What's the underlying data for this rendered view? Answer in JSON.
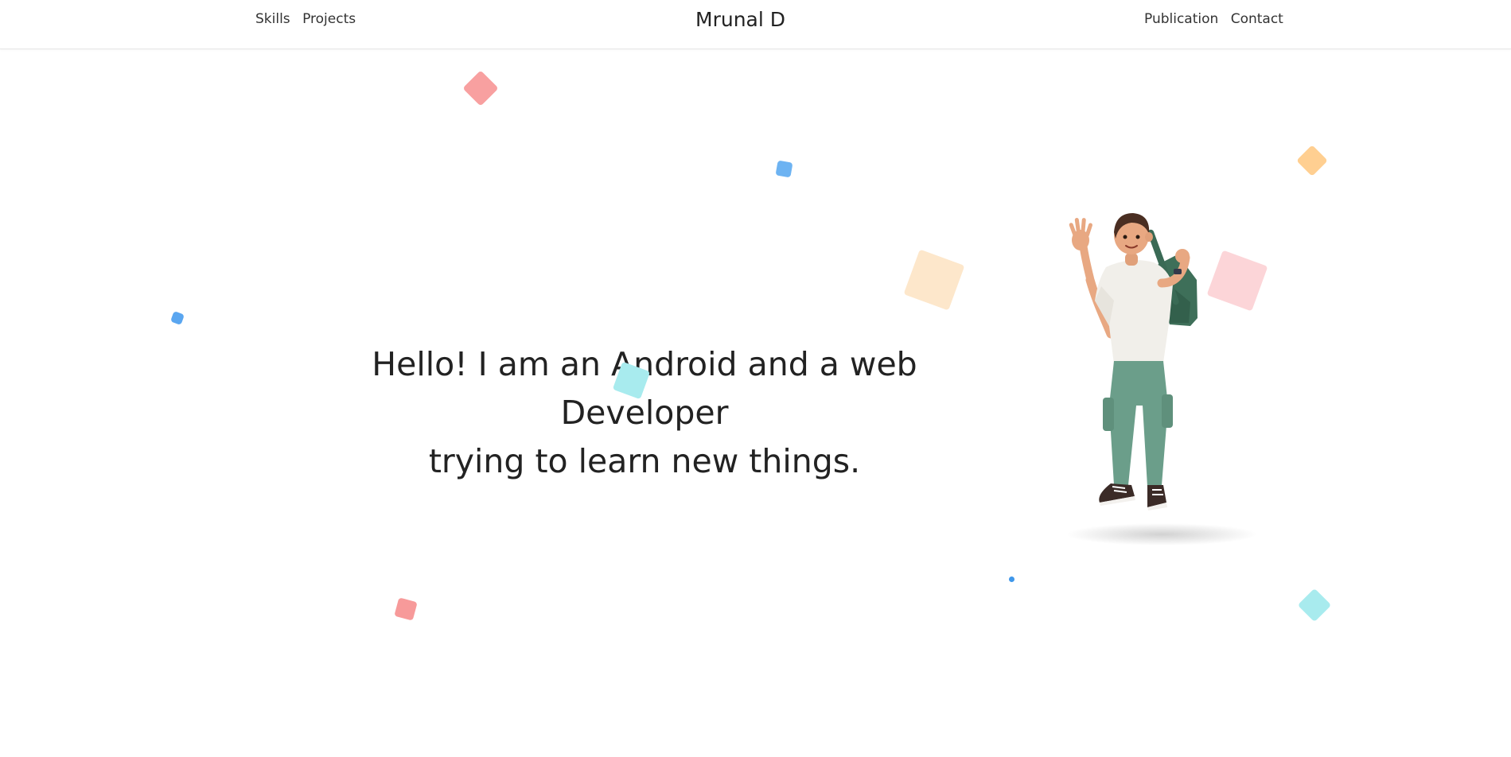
{
  "header": {
    "nav_left": [
      "Skills",
      "Projects"
    ],
    "brand": "Mrunal D",
    "nav_right": [
      "Publication",
      "Contact"
    ]
  },
  "hero": {
    "line1": "Hello! I am an Android and a web Developer",
    "line2": "trying to learn new things."
  },
  "illustration": {
    "name": "waving-developer-illustration",
    "colors": {
      "shirt": "#f1efea",
      "pants": "#6b9e8a",
      "backpack": "#3e6f59",
      "skin": "#e8a882",
      "hair": "#4a2e22"
    }
  },
  "decor_colors": [
    "#f8a0a0",
    "#6db3f2",
    "#ffcf91",
    "#fde7cb",
    "#fcd5d8",
    "#a8ebee"
  ]
}
